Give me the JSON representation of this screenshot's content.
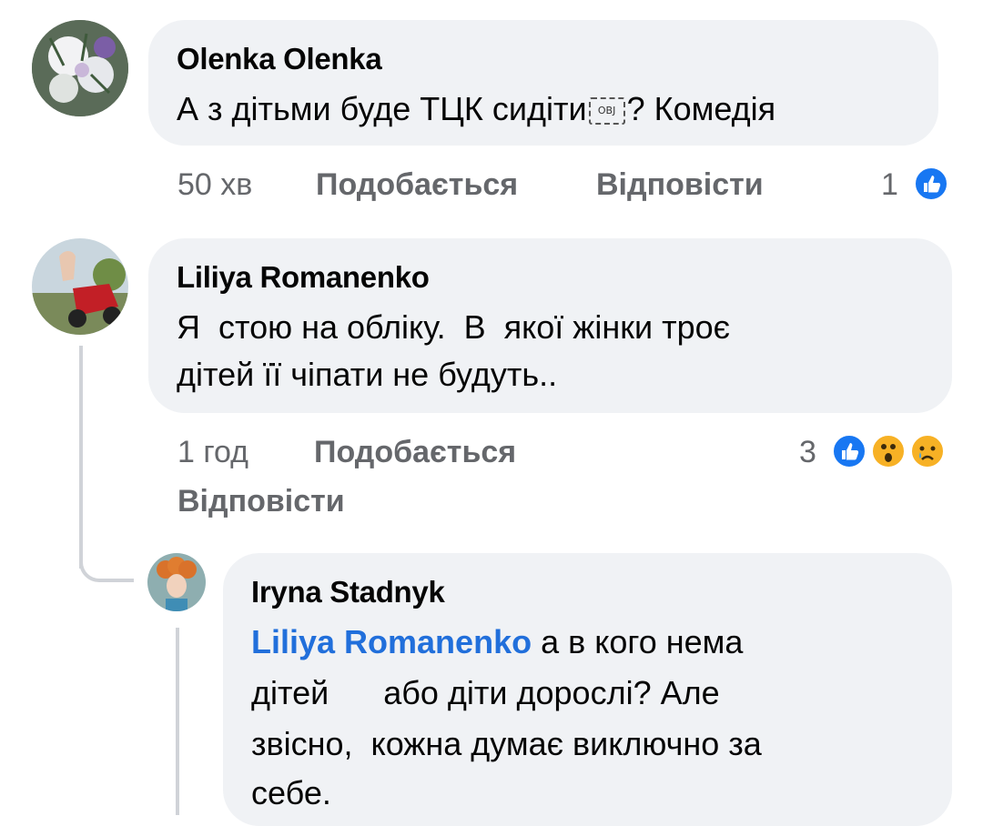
{
  "comments": [
    {
      "author": "Olenka Olenka",
      "text_before": "А з дітьми буде ТЦК сидіти",
      "obj_glyph": "OBJ",
      "text_after": "? Комедія",
      "time": "50 хв",
      "like_label": "Подобається",
      "reply_label": "Відповісти",
      "reaction_count": "1"
    },
    {
      "author": "Liliya Romanenko",
      "text_line1": "Я  стою на обліку.  В  якої жінки троє",
      "text_line2": "дітей її чіпати не будуть..",
      "time": "1 год",
      "like_label": "Подобається",
      "reply_label": "Відповісти",
      "reaction_count": "3"
    },
    {
      "author": "Iryna Stadnyk",
      "mention": "Liliya Romanenko",
      "line1_rest": " а в кого нема",
      "line2": "дітей      або діти дорослі? Але",
      "line3": "звісно,  кожна думає виключно за",
      "line4": "себе."
    }
  ],
  "colors": {
    "bubble": "#f0f2f5",
    "like_blue": "#1877f2",
    "mention_blue": "#216fdb",
    "meta_gray": "#65676b"
  }
}
